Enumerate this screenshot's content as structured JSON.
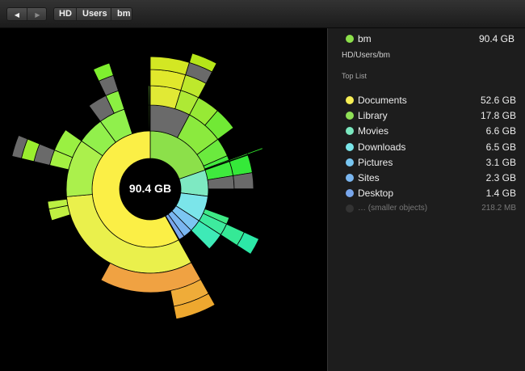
{
  "toolbar": {
    "back_icon": "back-arrow-icon",
    "back_glyph": "◀",
    "forward_icon": "forward-arrow-icon",
    "forward_glyph": "▶",
    "breadcrumbs": [
      "HD",
      "Users",
      "bm"
    ]
  },
  "sunburst": {
    "center_label": "90.4 GB"
  },
  "details": {
    "folder_name": "bm",
    "folder_size": "90.4 GB",
    "folder_color": "#8ce04a",
    "path": "HD/Users/bm",
    "top_list_heading": "Top List",
    "items": [
      {
        "label": "Documents",
        "size": "52.6 GB",
        "color": "#f7ef55"
      },
      {
        "label": "Library",
        "size": "17.8 GB",
        "color": "#8fe056"
      },
      {
        "label": "Movies",
        "size": "6.6 GB",
        "color": "#7be8c0"
      },
      {
        "label": "Downloads",
        "size": "6.5 GB",
        "color": "#7ae6ea"
      },
      {
        "label": "Pictures",
        "size": "3.1 GB",
        "color": "#78c6f2"
      },
      {
        "label": "Sites",
        "size": "2.3 GB",
        "color": "#7ab6f0"
      },
      {
        "label": "Desktop",
        "size": "1.4 GB",
        "color": "#78a6ec"
      },
      {
        "label": "… (smaller objects)",
        "size": "218.2 MB",
        "color": "#333333"
      }
    ]
  }
}
